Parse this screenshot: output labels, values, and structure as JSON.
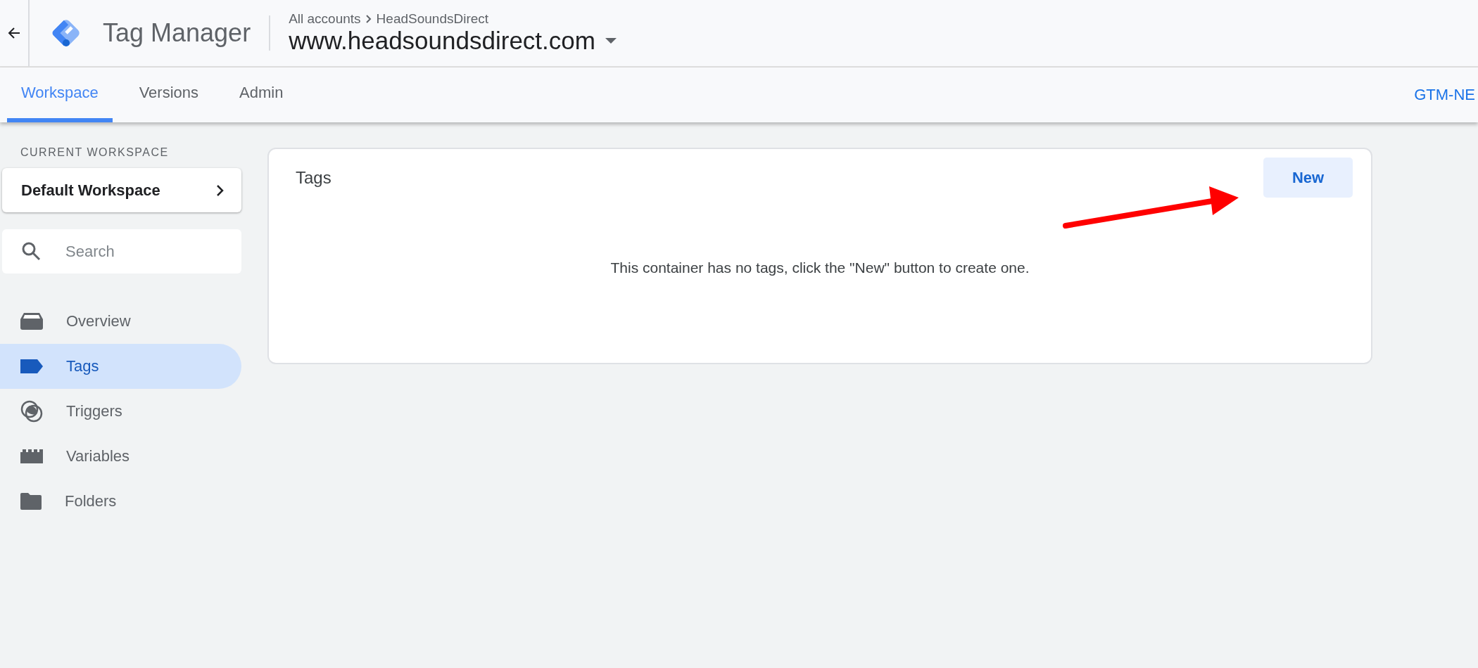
{
  "header": {
    "product": "Tag Manager",
    "breadcrumb": [
      "All accounts",
      "HeadSoundsDirect"
    ],
    "container": "www.headsoundsdirect.com"
  },
  "tabs": [
    {
      "label": "Workspace",
      "selected": true
    },
    {
      "label": "Versions",
      "selected": false
    },
    {
      "label": "Admin",
      "selected": false
    }
  ],
  "container_id": "GTM-NE",
  "sidebar": {
    "section_label": "CURRENT WORKSPACE",
    "workspace": "Default Workspace",
    "search": {
      "placeholder": "Search"
    },
    "items": [
      {
        "kind": "overview",
        "label": "Overview",
        "selected": false
      },
      {
        "kind": "tags",
        "label": "Tags",
        "selected": true
      },
      {
        "kind": "triggers",
        "label": "Triggers",
        "selected": false
      },
      {
        "kind": "variables",
        "label": "Variables",
        "selected": false
      },
      {
        "kind": "folders",
        "label": "Folders",
        "selected": false
      }
    ]
  },
  "card": {
    "title": "Tags",
    "button": "New",
    "empty_message": "This container has no tags, click the \"New\" button to create one."
  }
}
